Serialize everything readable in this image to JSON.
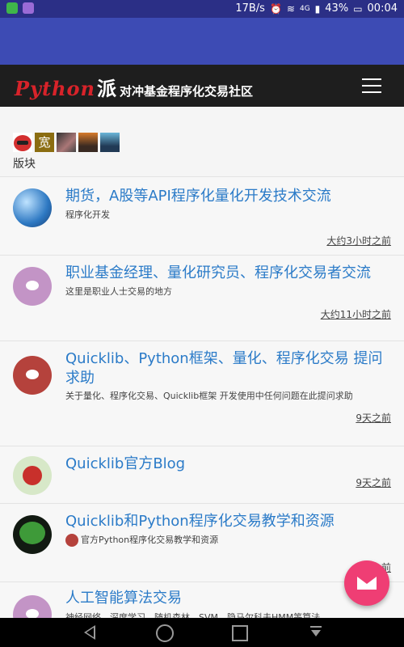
{
  "status_bar": {
    "speed": "17B/s",
    "battery": "43%",
    "time": "00:04",
    "network": "4G"
  },
  "site": {
    "logo_python": "Python",
    "logo_pai": "派",
    "logo_sub": "对冲基金程序化交易社区"
  },
  "online_users": [
    "宽"
  ],
  "section_label": "版块",
  "forums": [
    {
      "title": "期货，A股等API程序化量化开发技术交流",
      "desc": "程序化开发",
      "time": "大约3小时之前"
    },
    {
      "title": "职业基金经理、量化研究员、程序化交易者交流",
      "desc": "这里是职业人士交易的地方",
      "time": "大约11小时之前"
    },
    {
      "title": "Quicklib、Python框架、量化、程序化交易 提问求助",
      "desc": "关于量化、程序化交易、Quicklib框架 开发使用中任何问题在此提问求助",
      "time": "9天之前"
    },
    {
      "title": "Quicklib官方Blog",
      "desc": "",
      "time": "9天之前"
    },
    {
      "title": "Quicklib和Python程序化交易教学和资源",
      "desc": "官方Python程序化交易教学和资源",
      "time": "4天之前"
    },
    {
      "title": "人工智能算法交易",
      "desc": "神经网络、深度学习、随机森林、SVM、隐马尔科夫HMM等算法",
      "time": ""
    }
  ]
}
